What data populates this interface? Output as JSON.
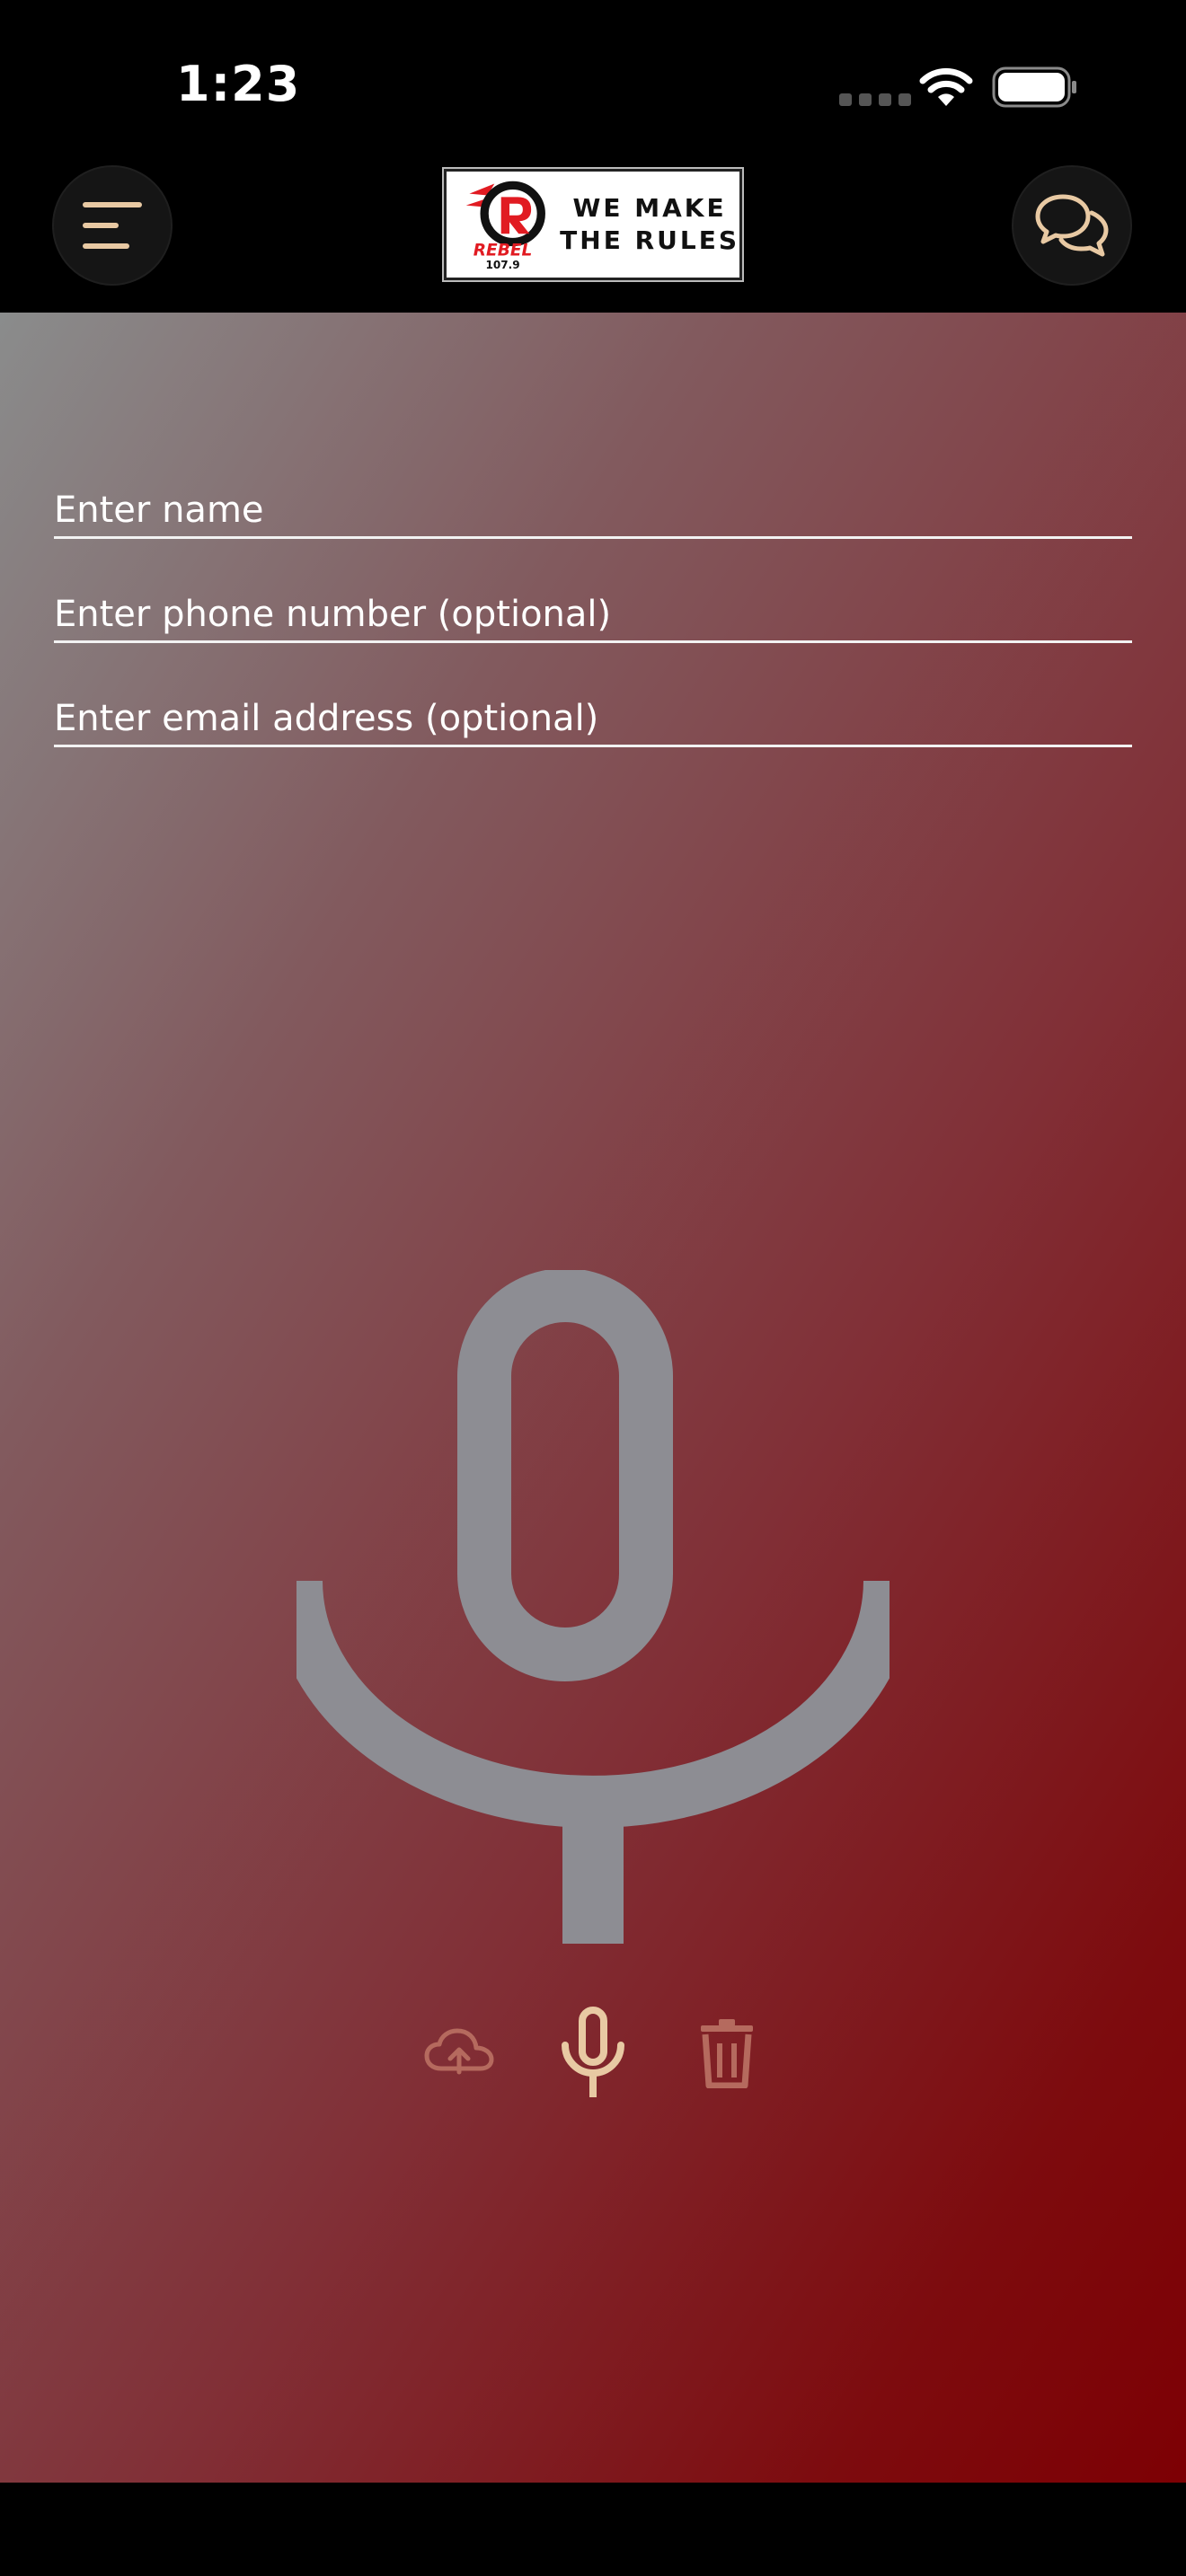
{
  "status_bar": {
    "time": "1:23",
    "icons": [
      "cellular-icon",
      "wifi-icon",
      "battery-icon"
    ]
  },
  "header": {
    "menu_icon": "menu-icon",
    "chat_icon": "chat-bubbles-icon",
    "logo": {
      "brand": "REBEL",
      "frequency": "107.9",
      "tagline_line1": "WE MAKE",
      "tagline_line2": "THE RULES"
    }
  },
  "form": {
    "name": {
      "value": "",
      "placeholder": "Enter name"
    },
    "phone": {
      "value": "",
      "placeholder": "Enter phone number (optional)"
    },
    "email": {
      "value": "",
      "placeholder": "Enter email address (optional)"
    }
  },
  "recorder": {
    "main_icon": "microphone-icon",
    "controls": [
      {
        "icon": "cloud-upload-icon",
        "enabled": false
      },
      {
        "icon": "microphone-icon",
        "enabled": true
      },
      {
        "icon": "trash-icon",
        "enabled": false
      }
    ]
  },
  "colors": {
    "accent": "#e8c9a3",
    "disabled": "#b56a5e",
    "mic_gray": "#8d8d93",
    "gradient_start": "#8a8c8c",
    "gradient_end": "#7d0004",
    "background": "#000000"
  }
}
